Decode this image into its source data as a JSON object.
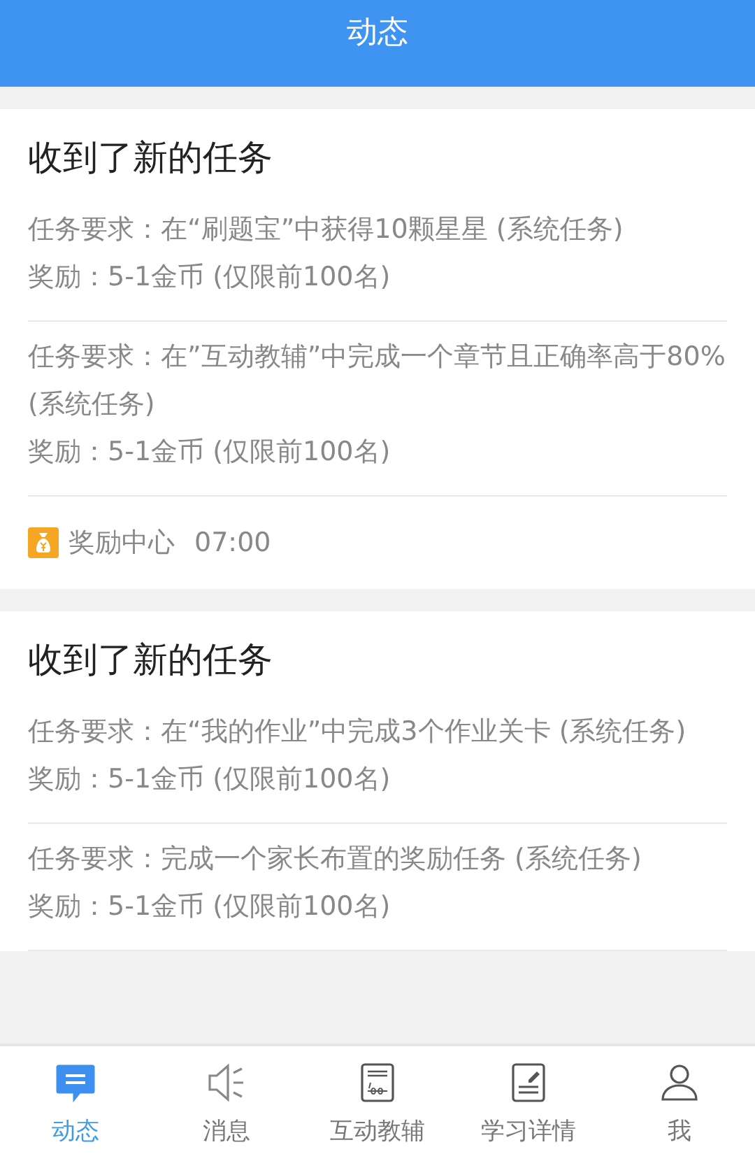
{
  "header": {
    "title": "动态"
  },
  "cards": [
    {
      "title": "收到了新的任务",
      "tasks": [
        {
          "requirement": "任务要求：在“刷题宝”中获得10颗星星 (系统任务)",
          "reward": "奖励：5-1金币 (仅限前100名)"
        },
        {
          "requirement": "任务要求：在”互动教辅”中完成一个章节且正确率高于80% (系统任务)",
          "reward": "奖励：5-1金币 (仅限前100名)"
        }
      ],
      "footer": {
        "label": "奖励中心",
        "time": "07:00"
      }
    },
    {
      "title": "收到了新的任务",
      "tasks": [
        {
          "requirement": "任务要求：在“我的作业”中完成3个作业关卡 (系统任务)",
          "reward": "奖励：5-1金币 (仅限前100名)"
        },
        {
          "requirement": "任务要求：完成一个家长布置的奖励任务 (系统任务)",
          "reward": "奖励：5-1金币 (仅限前100名)"
        }
      ]
    }
  ],
  "tabs": [
    {
      "kind": "chat",
      "label": "动态",
      "selected": true
    },
    {
      "kind": "speaker",
      "label": "消息",
      "selected": false
    },
    {
      "kind": "score",
      "label": "互动教辅",
      "selected": false
    },
    {
      "kind": "edit",
      "label": "学习详情",
      "selected": false
    },
    {
      "kind": "person",
      "label": "我",
      "selected": false
    }
  ]
}
